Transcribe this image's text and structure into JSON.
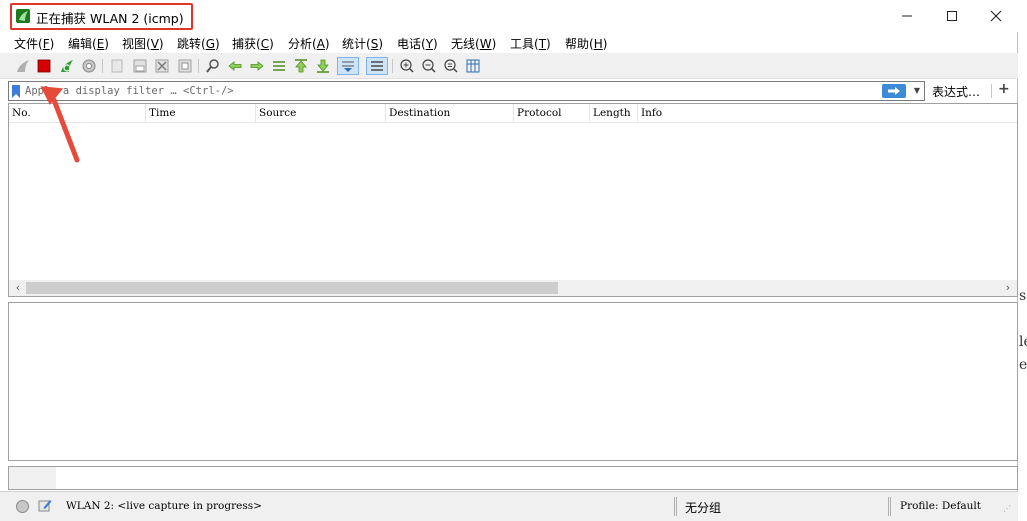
{
  "window": {
    "title": "正在捕获 WLAN 2 (icmp)",
    "minimize": "—",
    "maximize": "☐",
    "close": "✕"
  },
  "menu": [
    {
      "label": "文件(",
      "key": "F",
      "tail": ")"
    },
    {
      "label": "编辑(",
      "key": "E",
      "tail": ")"
    },
    {
      "label": "视图(",
      "key": "V",
      "tail": ")"
    },
    {
      "label": "跳转(",
      "key": "G",
      "tail": ")"
    },
    {
      "label": "捕获(",
      "key": "C",
      "tail": ")"
    },
    {
      "label": "分析(",
      "key": "A",
      "tail": ")"
    },
    {
      "label": "统计(",
      "key": "S",
      "tail": ")"
    },
    {
      "label": "电话(",
      "key": "Y",
      "tail": ")"
    },
    {
      "label": "无线(",
      "key": "W",
      "tail": ")"
    },
    {
      "label": "工具(",
      "key": "T",
      "tail": ")"
    },
    {
      "label": "帮助(",
      "key": "H",
      "tail": ")"
    }
  ],
  "toolbar": {
    "icons": [
      "start-capture-icon",
      "stop-capture-icon",
      "restart-capture-icon",
      "capture-options-icon",
      "open-file-icon",
      "save-file-icon",
      "close-file-icon",
      "reload-file-icon",
      "find-packet-icon",
      "go-back-icon",
      "go-forward-icon",
      "go-to-packet-icon",
      "go-first-icon",
      "go-last-icon",
      "autoscroll-icon",
      "colorize-icon",
      "zoom-in-icon",
      "zoom-out-icon",
      "zoom-normal-icon",
      "resize-columns-icon"
    ]
  },
  "filter": {
    "placeholder": "Apply a display filter … <Ctrl-/>",
    "expression_label": "表达式…",
    "add_label": "+"
  },
  "packet_list": {
    "columns": [
      "No.",
      "Time",
      "Source",
      "Destination",
      "Protocol",
      "Length",
      "Info"
    ]
  },
  "status": {
    "capture_text": "WLAN 2: <live capture in progress>",
    "packets_text": "无分组",
    "profile_text": "Profile: Default"
  },
  "side_fragment": {
    "lines": [
      "ss",
      "le",
      "e)"
    ]
  },
  "colors": {
    "annotation_red": "#e0352b",
    "stop_red": "#d40000",
    "apply_blue": "#3c8ad8"
  }
}
